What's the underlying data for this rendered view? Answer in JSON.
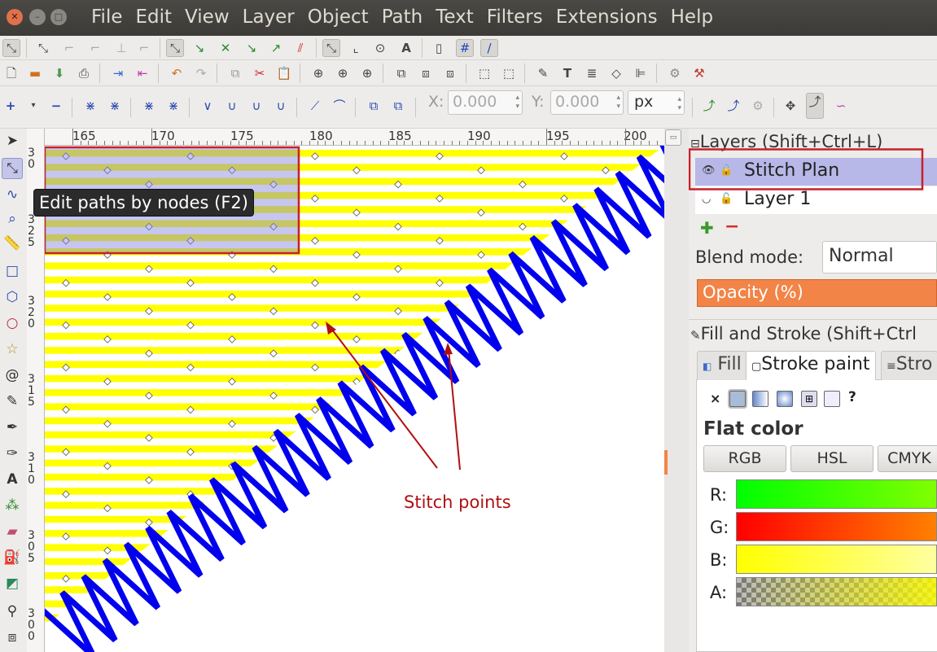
{
  "menubar": {
    "items": [
      "File",
      "Edit",
      "View",
      "Layer",
      "Object",
      "Path",
      "Text",
      "Filters",
      "Extensions",
      "Help"
    ],
    "window_buttons": [
      "close",
      "minimize",
      "maximize"
    ]
  },
  "tool_controls": {
    "x_label": "X:",
    "x_value": "0.000",
    "y_label": "Y:",
    "y_value": "0.000",
    "unit": "px"
  },
  "ruler": {
    "horizontal_labels": [
      "165",
      "170",
      "175",
      "180",
      "185",
      "190",
      "195",
      "200"
    ],
    "vertical_groups": [
      [
        "3",
        "0"
      ],
      [
        "3",
        "2",
        "5"
      ],
      [
        "3",
        "2",
        "0"
      ],
      [
        "3",
        "1",
        "5"
      ],
      [
        "3",
        "1",
        "0"
      ],
      [
        "3",
        "0",
        "5"
      ],
      [
        "3",
        "0",
        "0"
      ]
    ]
  },
  "tooltip": "Edit paths by nodes (F2)",
  "canvas": {
    "annotation_label": "Stitch points",
    "colors": {
      "fill_stripes": "#ffff00",
      "stroke_zigzag": "#0000ee",
      "annotation": "#b01010",
      "selection_box": "#c8202a"
    }
  },
  "layers_panel": {
    "title": "Layers (Shift+Ctrl+L)",
    "layers": [
      {
        "name": "Stitch Plan",
        "selected": true
      },
      {
        "name": "Layer 1",
        "selected": false
      }
    ],
    "blend_label": "Blend mode:",
    "blend_value": "Normal",
    "opacity_label": "Opacity (%)"
  },
  "fill_stroke_panel": {
    "title": "Fill and Stroke (Shift+Ctrl",
    "tabs": [
      "Fill",
      "Stroke paint",
      "Stro"
    ],
    "heading": "Flat color",
    "mode_buttons": [
      "RGB",
      "HSL",
      "CMYK"
    ],
    "channels": [
      "R:",
      "G:",
      "B:",
      "A:"
    ]
  }
}
